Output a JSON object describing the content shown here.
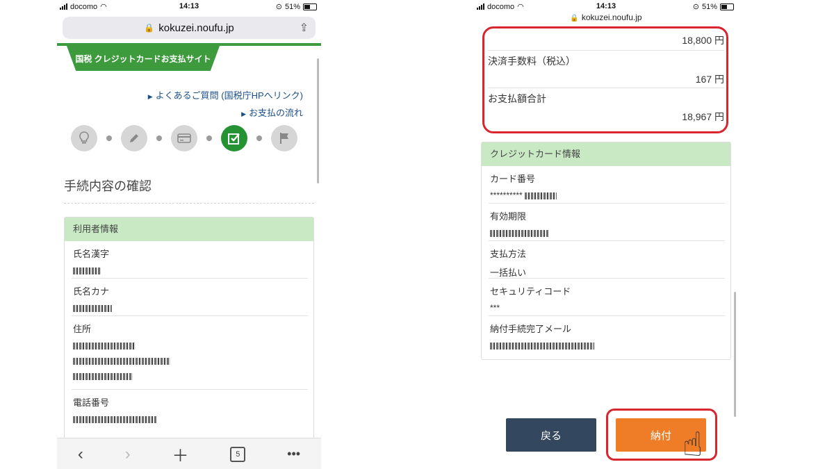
{
  "left": {
    "status": {
      "carrier": "docomo",
      "time": "14:13",
      "battery": "51%"
    },
    "url": "kokuzei.noufu.jp",
    "banner": "国税 クレジットカードお支払サイト",
    "links": {
      "faq": "よくあるご質問 (国税庁HPへリンク)",
      "flow": "お支払の流れ"
    },
    "steps": [
      {
        "icon": "lightbulb-icon",
        "active": false
      },
      {
        "icon": "pencil-icon",
        "active": false
      },
      {
        "icon": "credit-card-icon",
        "active": false
      },
      {
        "icon": "checkbox-icon",
        "active": true
      },
      {
        "icon": "flag-icon",
        "active": false
      }
    ],
    "page_title": "手続内容の確認",
    "user_info": {
      "header": "利用者情報",
      "fields": [
        {
          "label": "氏名漢字"
        },
        {
          "label": "氏名カナ"
        },
        {
          "label": "住所"
        },
        {
          "label": "電話番号"
        }
      ]
    },
    "bottom": {
      "tab_count": "5"
    }
  },
  "right": {
    "status": {
      "carrier": "docomo",
      "time": "14:13",
      "battery": "51%"
    },
    "url": "kokuzei.noufu.jp",
    "amounts": {
      "tax_amount": "18,800 円",
      "fee_label": "決済手数料（税込）",
      "fee_amount": "167 円",
      "total_label": "お支払額合計",
      "total_amount": "18,967 円"
    },
    "card_info": {
      "header": "クレジットカード情報",
      "fields": [
        {
          "label": "カード番号",
          "value": "**********"
        },
        {
          "label": "有効期限",
          "value": ""
        },
        {
          "label": "支払方法",
          "value": "一括払い"
        },
        {
          "label": "セキュリティコード",
          "value": "***"
        },
        {
          "label": "納付手続完了メール",
          "value": ""
        }
      ]
    },
    "buttons": {
      "back": "戻る",
      "pay": "納付"
    }
  }
}
